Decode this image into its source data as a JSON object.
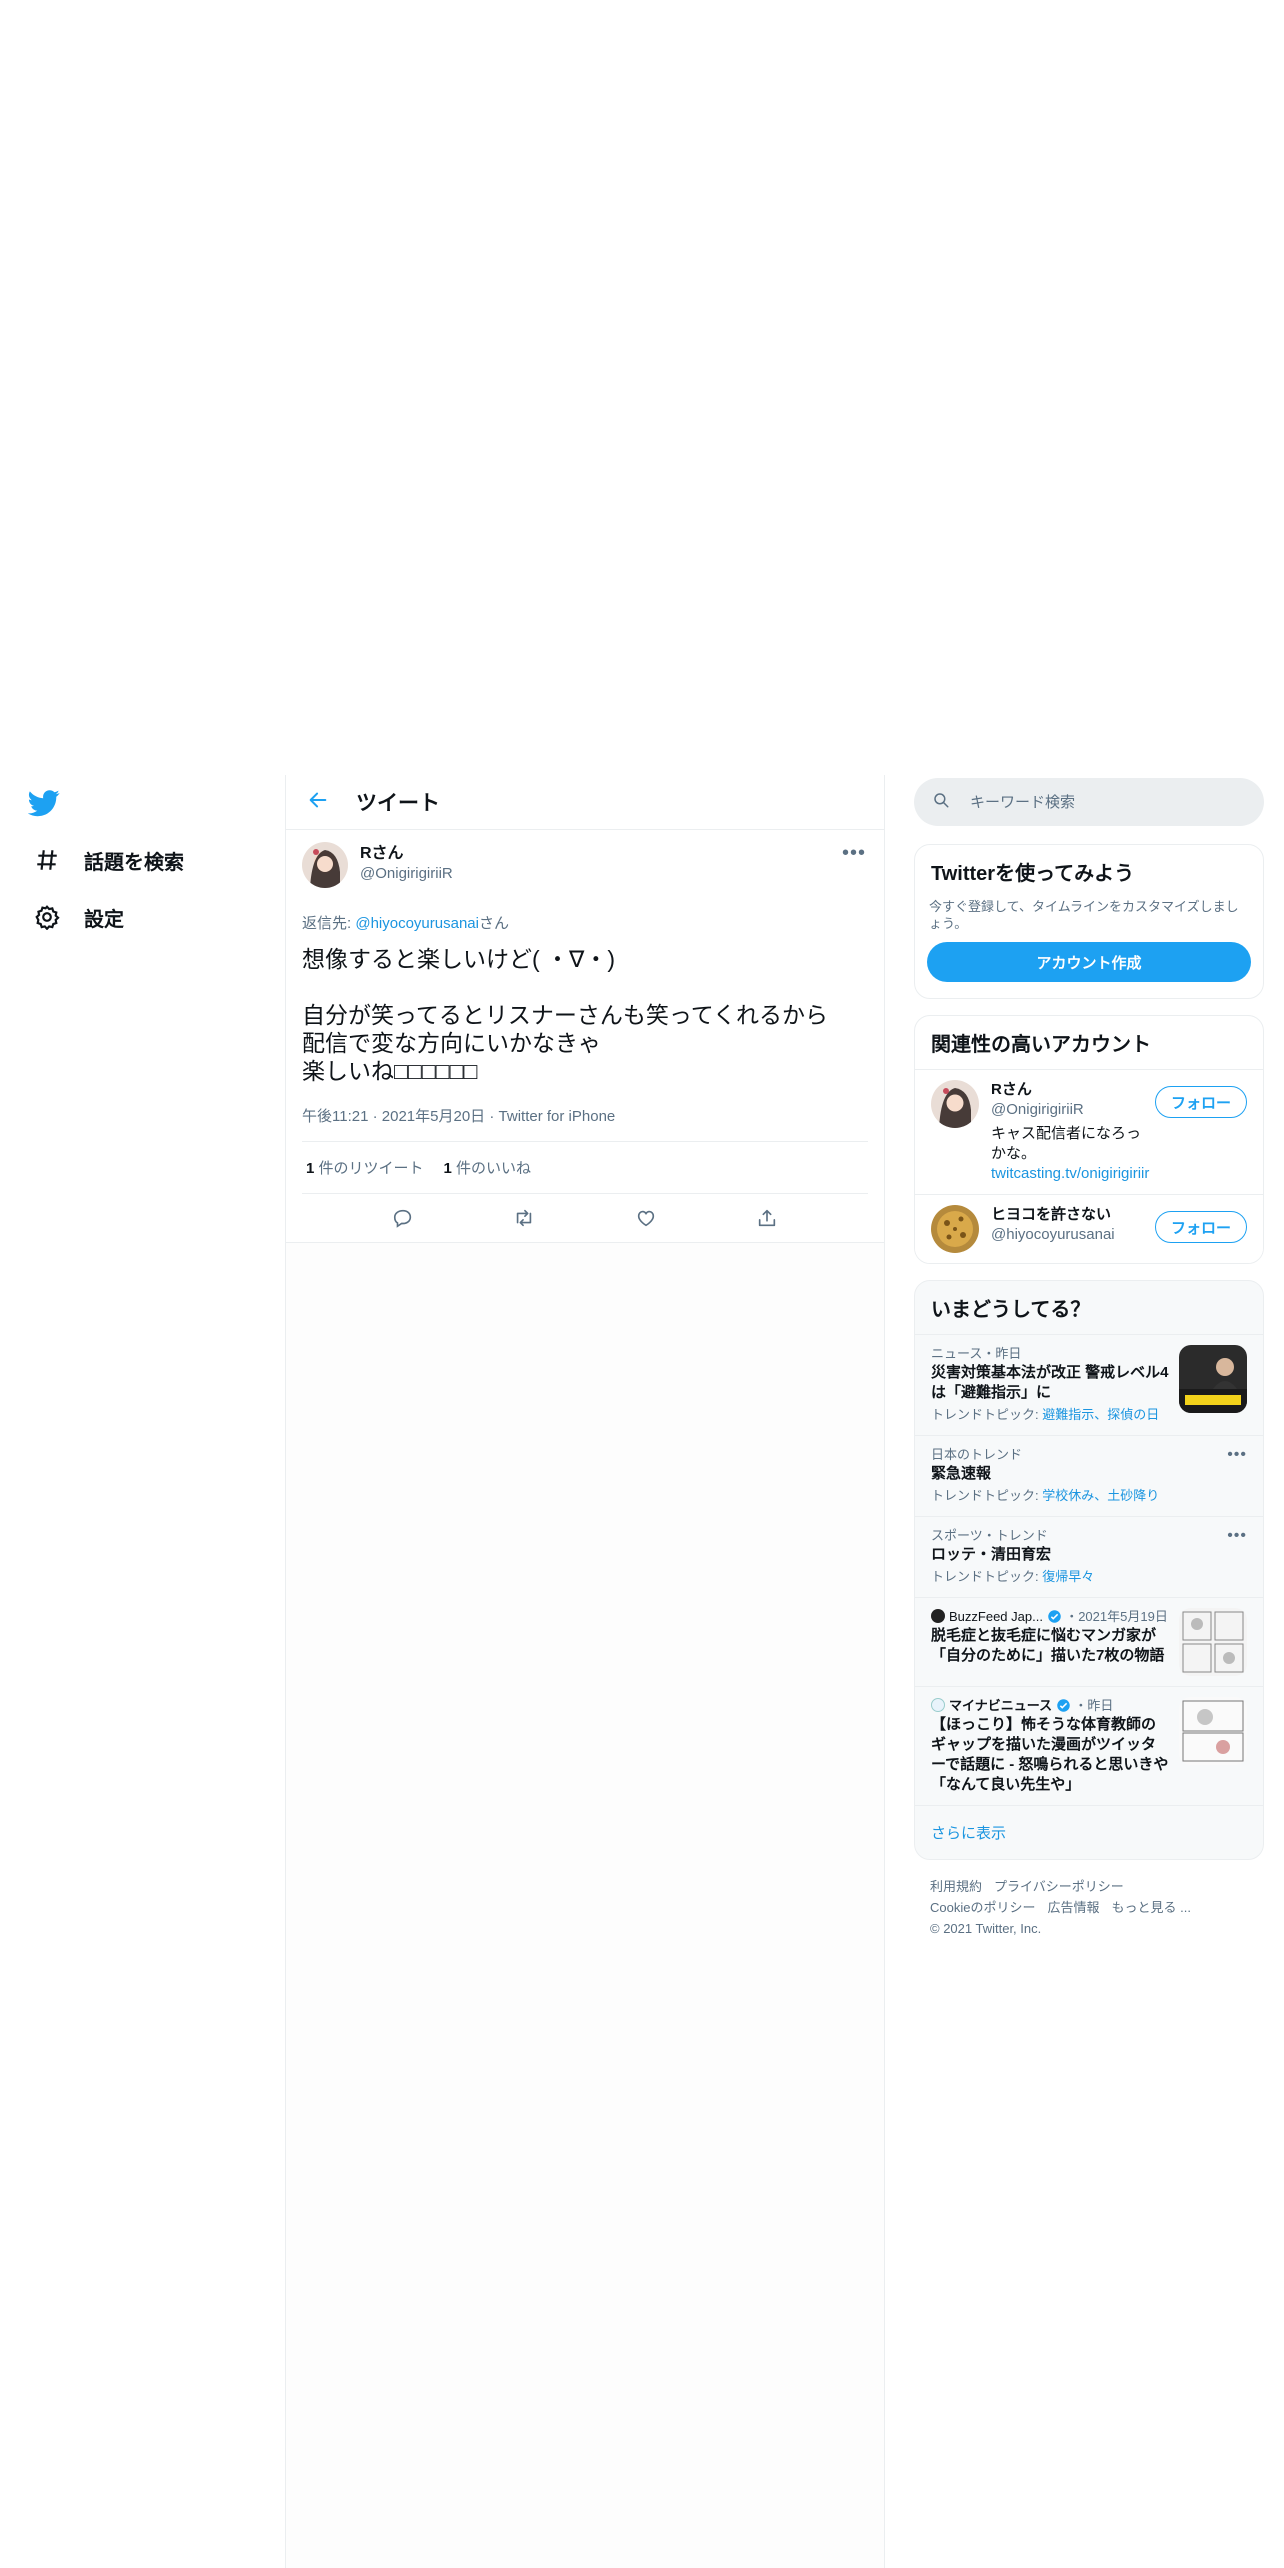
{
  "nav": {
    "logo": "twitter-bird-icon",
    "items": [
      {
        "label": "話題を検索",
        "icon": "hashtag-icon"
      },
      {
        "label": "設定",
        "icon": "gear-icon"
      }
    ]
  },
  "main": {
    "header_title": "ツイート",
    "tweet": {
      "author_name": "Rさん",
      "author_handle": "@OnigirigiriiR",
      "reply_prefix": "返信先: ",
      "reply_to": "@hiyocoyurusanai",
      "reply_suffix": "さん",
      "text": "想像すると楽しいけど( ・∇・)\n\n自分が笑ってるとリスナーさんも笑ってくれるから\n配信で変な方向にいかなきゃ\n楽しいね□□□□□□",
      "time": "午後11:21",
      "date": "2021年5月20日",
      "source": "Twitter for iPhone",
      "retweets_count": "1",
      "retweets_label": " 件のリツイート",
      "likes_count": "1",
      "likes_label": " 件のいいね"
    }
  },
  "sidebar": {
    "search_placeholder": "キーワード検索",
    "signup": {
      "title": "Twitterを使ってみよう",
      "desc": "今すぐ登録して、タイムラインをカスタマイズしましょう。",
      "button": "アカウント作成"
    },
    "related": {
      "title": "関連性の高いアカウント",
      "follow_label": "フォロー",
      "accounts": [
        {
          "name": "Rさん",
          "handle": "@OnigirigiriiR",
          "bio": "キャス配信者になろっかな。",
          "link": "twitcasting.tv/onigirigiriir"
        },
        {
          "name": "ヒヨコを許さない",
          "handle": "@hiyocoyurusanai"
        }
      ]
    },
    "trends": {
      "title": "いまどうしてる？",
      "items": [
        {
          "meta": "ニュース・昨日",
          "title": "災害対策基本法が改正 警戒レベル4は「避難指示」に",
          "topics_prefix": "トレンドトピック: ",
          "topics": "避難指示、探偵の日"
        },
        {
          "meta": "日本のトレンド",
          "title": "緊急速報",
          "topics_prefix": "トレンドトピック: ",
          "topics": "学校休み、土砂降り"
        },
        {
          "meta": "スポーツ・トレンド",
          "title": "ロッテ・清田育宏",
          "topics_prefix": "トレンドトピック: ",
          "topics": "復帰早々"
        },
        {
          "source": "BuzzFeed Jap...",
          "meta": "・2021年5月19日",
          "title": "脱毛症と抜毛症に悩むマンガ家が「自分のために」描いた7枚の物語"
        },
        {
          "source": "マイナビニュース",
          "meta": "・昨日",
          "title": "【ほっこり】怖そうな体育教師のギャップを描いた漫画がツイッターで話題に - 怒鳴られると思いきや「なんて良い先生や」"
        }
      ],
      "show_more": "さらに表示"
    },
    "footer": {
      "links": [
        "利用規約",
        "プライバシーポリシー",
        "Cookieのポリシー",
        "広告情報",
        "もっと見る ..."
      ],
      "copyright": "© 2021 Twitter, Inc."
    }
  }
}
